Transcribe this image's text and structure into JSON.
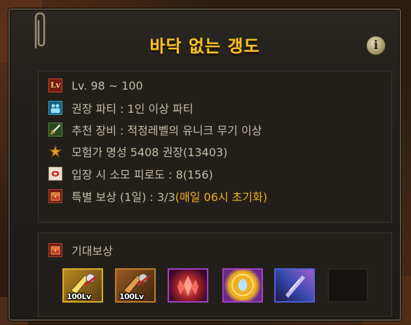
{
  "dungeon": {
    "title": "바닥 없는 갱도",
    "info_icon": "info-icon",
    "info_label": "i"
  },
  "info_rows": {
    "level": {
      "icon": "level-icon",
      "icon_label": "Lv",
      "text": "Lv. 98 ~ 100"
    },
    "party": {
      "icon": "party-icon",
      "text": "권장 파티 : 1인 이상 파티"
    },
    "equipment": {
      "icon": "sword-icon",
      "text": "추천 장비 : 적정레벨의 유니크 무기 이상"
    },
    "fame": {
      "icon": "fame-icon",
      "text": "모험가 명성 5408 권장(13403)"
    },
    "fatigue": {
      "icon": "fatigue-icon",
      "text": "입장 시 소모 피로도 : 8(156)"
    },
    "special_reward": {
      "icon": "chest-icon",
      "text": "특별 보상 (1일) : 3/3 ",
      "highlight": "(매일 06시 초기화)"
    }
  },
  "rewards": {
    "title": "기대보상",
    "icon": "chest-icon",
    "items": [
      {
        "icon": "gold-weapon-box-icon",
        "badge": "100Lv"
      },
      {
        "icon": "bronze-weapon-box-icon",
        "badge": "100Lv"
      },
      {
        "icon": "red-crystal-icon",
        "badge": ""
      },
      {
        "icon": "gold-orb-icon",
        "badge": ""
      },
      {
        "icon": "violet-shard-icon",
        "badge": ""
      },
      {
        "icon": "empty-slot",
        "badge": ""
      }
    ]
  },
  "colors": {
    "title": "#f5c12a",
    "text": "#c4bca8",
    "highlight": "#f0b020",
    "panel": "#221f1b"
  }
}
